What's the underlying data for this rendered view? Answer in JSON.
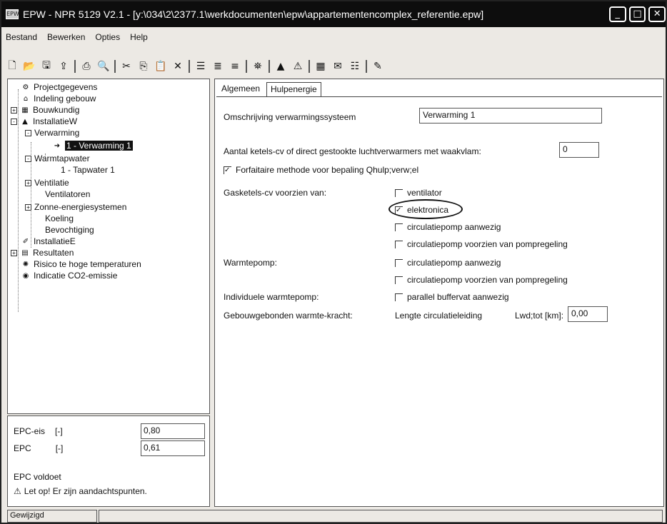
{
  "window": {
    "title": "EPW - NPR 5129 V2.1 - [y:\\034\\2\\2377.1\\werkdocumenten\\epw\\appartementencomplex_referentie.epw]",
    "buttons": [
      "minimize-icon",
      "maximize-icon",
      "close-icon"
    ]
  },
  "menu": [
    "Bestand",
    "Bewerken",
    "Opties",
    "Help"
  ],
  "toolbar": {
    "icons": [
      "new-file-icon",
      "open-folder-icon",
      "save-icon",
      "upload-icon",
      "print-icon",
      "print-preview-icon",
      "cut-icon",
      "copy-icon",
      "paste-icon",
      "delete-icon",
      "list-icon",
      "list-detail-icon",
      "list-tree-icon",
      "binoculars-icon",
      "chart-icon",
      "warning-icon",
      "calculator-icon",
      "report-icon",
      "settings-icon",
      "help-book-icon"
    ]
  },
  "tree": {
    "items": [
      {
        "label": "Projectgegevens",
        "icon": "project-icon"
      },
      {
        "label": "Indeling gebouw",
        "icon": "building-icon"
      },
      {
        "label": "Bouwkundig",
        "icon": "grid-icon",
        "expander": "+"
      },
      {
        "label": "InstallatieW",
        "icon": "installation-icon",
        "expander": "-"
      },
      {
        "label": "Verwarming",
        "expander": "-"
      },
      {
        "label": "1 - Verwarming 1",
        "icon": "arrow-icon",
        "selected": true
      },
      {
        "label": "Warmtapwater",
        "expander": "-"
      },
      {
        "label": "1 - Tapwater 1"
      },
      {
        "label": "Ventilatie",
        "expander": "+"
      },
      {
        "label": "Ventilatoren"
      },
      {
        "label": "Zonne-energiesystemen",
        "expander": "+"
      },
      {
        "label": "Koeling"
      },
      {
        "label": "Bevochtiging"
      },
      {
        "label": "InstallatieE",
        "icon": "wrench-icon"
      },
      {
        "label": "Resultaten",
        "icon": "results-icon",
        "expander": "+"
      },
      {
        "label": "Risico te hoge temperaturen",
        "icon": "sun-icon"
      },
      {
        "label": "Indicatie CO2-emissie",
        "icon": "globe-icon"
      }
    ]
  },
  "epc": {
    "eis_label": "EPC-eis",
    "eis_unit": "[-]",
    "eis_value": "0,80",
    "epc_label": "EPC",
    "epc_unit": "[-]",
    "epc_value": "0,61",
    "status": "EPC voldoet",
    "warning": "Let op! Er zijn aandachtspunten."
  },
  "tabs": [
    {
      "label": "Algemeen",
      "active": false
    },
    {
      "label": "Hulpenergie",
      "active": true
    }
  ],
  "form": {
    "omschrijving_label": "Omschrijving verwarmingssysteem",
    "omschrijving_value": "Verwarming 1",
    "aantal_label": "Aantal ketels-cv of direct gestookte luchtverwarmers met waakvlam:",
    "aantal_value": "0",
    "forfaitaire_label": "Forfaitaire methode voor bepaling Qhulp;verw;el",
    "forfaitaire_checked": true,
    "gasketels_label": "Gasketels-cv voorzien van:",
    "gasketels_options": [
      {
        "label": "ventilator",
        "checked": false
      },
      {
        "label": "elektronica",
        "checked": true
      },
      {
        "label": "circulatiepomp aanwezig",
        "checked": false
      },
      {
        "label": "circulatiepomp voorzien van pompregeling",
        "checked": false
      }
    ],
    "warmtepomp_label": "Warmtepomp:",
    "warmtepomp_options": [
      {
        "label": "circulatiepomp aanwezig",
        "checked": false
      },
      {
        "label": "circulatiepomp voorzien van pompregeling",
        "checked": false
      }
    ],
    "individuele_label": "Individuele warmtepomp:",
    "individuele_option": {
      "label": "parallel buffervat aanwezig",
      "checked": false
    },
    "gebouw_label": "Gebouwgebonden warmte-kracht:",
    "lengte_label": "Lengte circulatieleiding",
    "lwd_label": "Lwd;tot [km]:",
    "lwd_value": "0,00"
  },
  "status": {
    "left": "Gewijzigd"
  }
}
